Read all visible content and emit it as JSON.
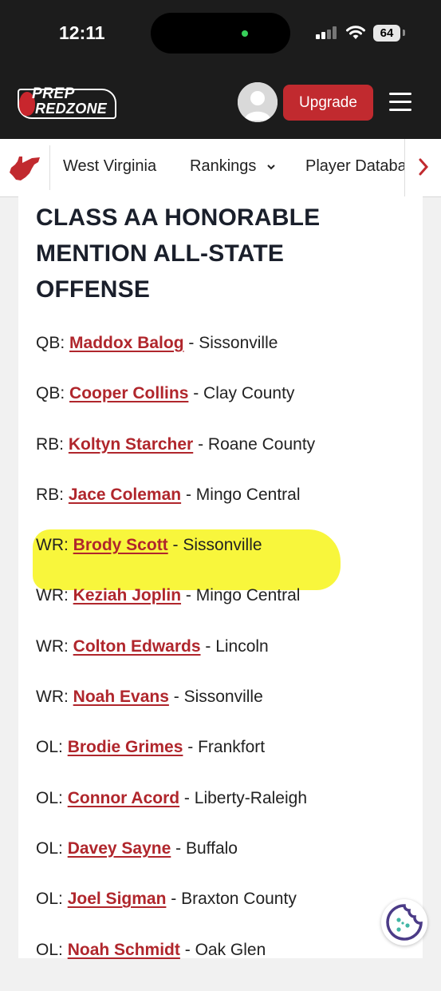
{
  "status_bar": {
    "time": "12:11",
    "battery": "64"
  },
  "header": {
    "logo_top": "PREP",
    "logo_bottom": "REDZONE",
    "upgrade_label": "Upgrade",
    "brand_color": "#c12a2f"
  },
  "subnav": {
    "state": "West Virginia",
    "rankings": "Rankings",
    "player_database": "Player Databa"
  },
  "article": {
    "heading": "CLASS AA HONORABLE MENTION ALL-STATE OFFENSE",
    "entries": [
      {
        "pos": "QB:",
        "player": "Maddox Balog",
        "school": "Sissonville"
      },
      {
        "pos": "QB:",
        "player": "Cooper Collins",
        "school": "Clay County"
      },
      {
        "pos": "RB:",
        "player": "Koltyn Starcher",
        "school": "Roane County"
      },
      {
        "pos": "RB:",
        "player": "Jace Coleman",
        "school": "Mingo Central"
      },
      {
        "pos": "WR:",
        "player": "Brody Scott",
        "school": "Sissonville",
        "highlighted": true
      },
      {
        "pos": "WR:",
        "player": "Keziah Joplin",
        "school": "Mingo Central"
      },
      {
        "pos": "WR:",
        "player": "Colton Edwards",
        "school": "Lincoln"
      },
      {
        "pos": "WR:",
        "player": "Noah Evans",
        "school": "Sissonville"
      },
      {
        "pos": "OL:",
        "player": "Brodie Grimes",
        "school": "Frankfort"
      },
      {
        "pos": "OL:",
        "player": "Connor Acord",
        "school": "Liberty-Raleigh"
      },
      {
        "pos": "OL:",
        "player": "Davey Sayne",
        "school": "Buffalo"
      },
      {
        "pos": "OL:",
        "player": "Joel Sigman",
        "school": "Braxton County"
      },
      {
        "pos": "OL:",
        "player": "Noah Schmidt",
        "school": "Oak Glen"
      }
    ]
  }
}
